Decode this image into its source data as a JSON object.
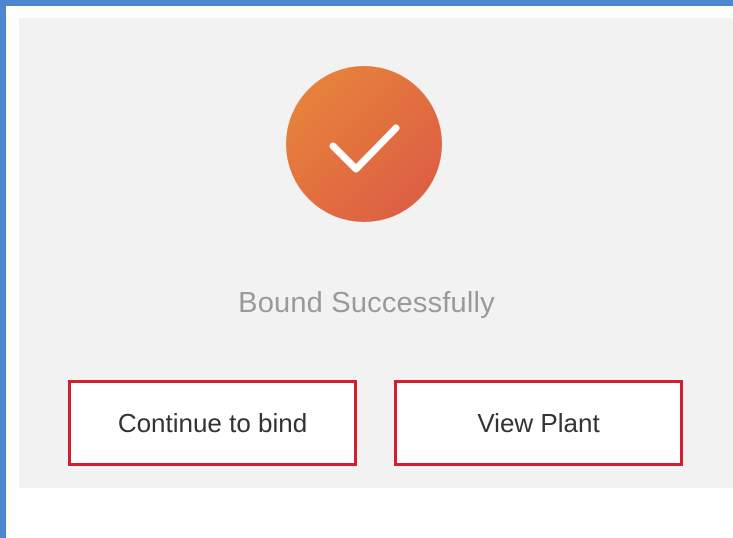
{
  "status": {
    "message": "Bound Successfully",
    "icon": "check-circle-icon",
    "icon_gradient": [
      "#e8893a",
      "#da5847"
    ]
  },
  "actions": {
    "continue_label": "Continue to bind",
    "view_label": "View Plant"
  },
  "colors": {
    "highlight_border": "#d0202e",
    "frame_border": "#4f86d0",
    "card_background": "#f2f2f2"
  }
}
